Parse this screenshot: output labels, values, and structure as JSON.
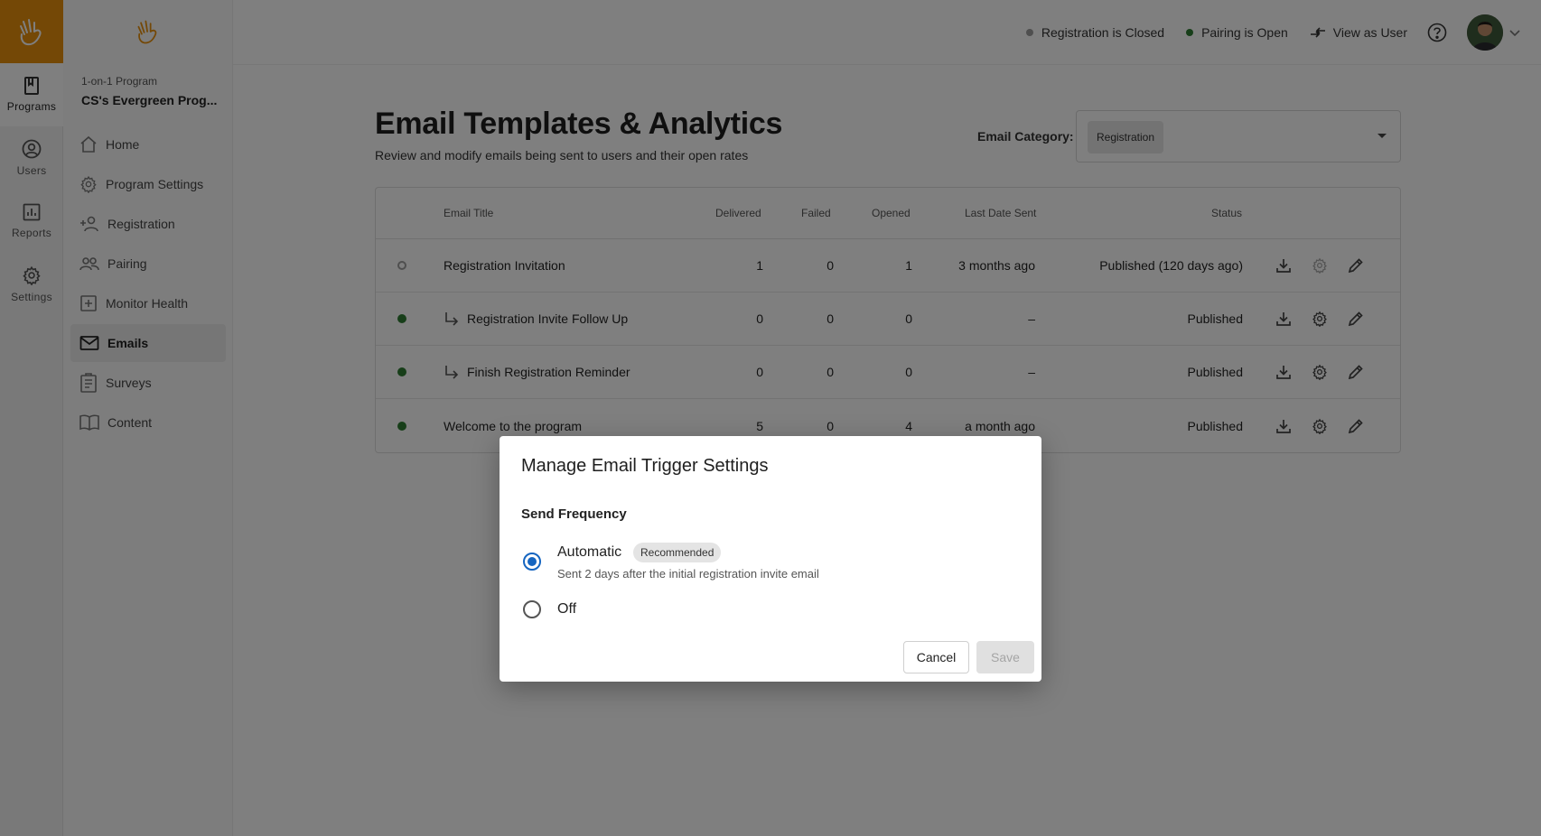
{
  "rail": {
    "items": [
      {
        "label": "Programs",
        "icon": "book-icon",
        "active": true
      },
      {
        "label": "Users",
        "icon": "user-circle-icon",
        "active": false
      },
      {
        "label": "Reports",
        "icon": "bar-chart-icon",
        "active": false
      },
      {
        "label": "Settings",
        "icon": "gear-icon",
        "active": false
      }
    ]
  },
  "sidebar": {
    "program_type": "1-on-1 Program",
    "program_name": "CS's Evergreen Prog...",
    "items": [
      {
        "label": "Home",
        "icon": "home-icon"
      },
      {
        "label": "Program Settings",
        "icon": "gear-icon"
      },
      {
        "label": "Registration",
        "icon": "person-add-icon"
      },
      {
        "label": "Pairing",
        "icon": "people-icon"
      },
      {
        "label": "Monitor Health",
        "icon": "health-plus-icon"
      },
      {
        "label": "Emails",
        "icon": "mail-icon",
        "active": true
      },
      {
        "label": "Surveys",
        "icon": "clipboard-icon"
      },
      {
        "label": "Content",
        "icon": "book-open-icon"
      }
    ]
  },
  "topbar": {
    "registration_status": "Registration is Closed",
    "pairing_status": "Pairing is Open",
    "view_as_user": "View as User",
    "colors": {
      "closed": "#9e9e9e",
      "open": "#2e7d32"
    }
  },
  "main": {
    "title": "Email Templates & Analytics",
    "subtitle": "Review and modify emails being sent to users and their open rates",
    "category_label": "Email Category:",
    "category_value": "Registration"
  },
  "table": {
    "headers": {
      "title": "Email Title",
      "delivered": "Delivered",
      "failed": "Failed",
      "opened": "Opened",
      "last_sent": "Last Date Sent",
      "status": "Status"
    },
    "rows": [
      {
        "title": "Registration Invitation",
        "child": false,
        "delivered": "1",
        "failed": "0",
        "opened": "1",
        "last_sent": "3 months ago",
        "status": "Published (120 days ago)",
        "dot": "hollow"
      },
      {
        "title": "Registration Invite Follow Up",
        "child": true,
        "delivered": "0",
        "failed": "0",
        "opened": "0",
        "last_sent": "–",
        "status": "Published",
        "dot": "green"
      },
      {
        "title": "Finish Registration Reminder",
        "child": true,
        "delivered": "0",
        "failed": "0",
        "opened": "0",
        "last_sent": "–",
        "status": "Published",
        "dot": "green"
      },
      {
        "title": "Welcome to the program",
        "child": false,
        "delivered": "5",
        "failed": "0",
        "opened": "4",
        "last_sent": "a month ago",
        "status": "Published",
        "dot": "green"
      }
    ]
  },
  "modal": {
    "title": "Manage Email Trigger Settings",
    "section": "Send Frequency",
    "option_auto": "Automatic",
    "recommended": "Recommended",
    "auto_desc": "Sent 2 days after the initial registration invite email",
    "option_off": "Off",
    "cancel": "Cancel",
    "save": "Save",
    "selected": "Automatic",
    "accent": "#1565c0"
  }
}
